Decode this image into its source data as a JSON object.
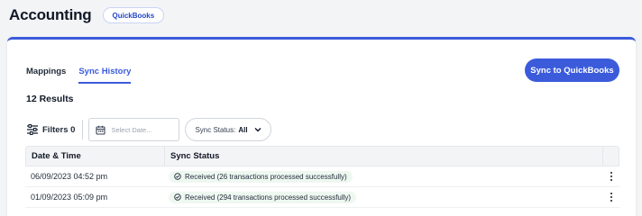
{
  "header": {
    "title": "Accounting",
    "integration_pill": "QuickBooks"
  },
  "tabs": [
    {
      "label": "Mappings",
      "active": false
    },
    {
      "label": "Sync History",
      "active": true
    }
  ],
  "actions": {
    "sync_button": "Sync to QuickBooks"
  },
  "results": {
    "label": "12 Results"
  },
  "filters": {
    "label": "Filters 0",
    "date_placeholder": "Select Date...",
    "status_prefix": "Sync Status:",
    "status_value": "All"
  },
  "table": {
    "columns": [
      "Date & Time",
      "Sync Status"
    ],
    "rows": [
      {
        "datetime": "06/09/2023 04:52 pm",
        "status": "Received (26 transactions processed successfully)"
      },
      {
        "datetime": "01/09/2023 05:09 pm",
        "status": "Received (294 transactions processed successfully)"
      }
    ]
  },
  "colors": {
    "accent": "#3b5bdb",
    "success_badge_bg": "#eef8f1"
  }
}
